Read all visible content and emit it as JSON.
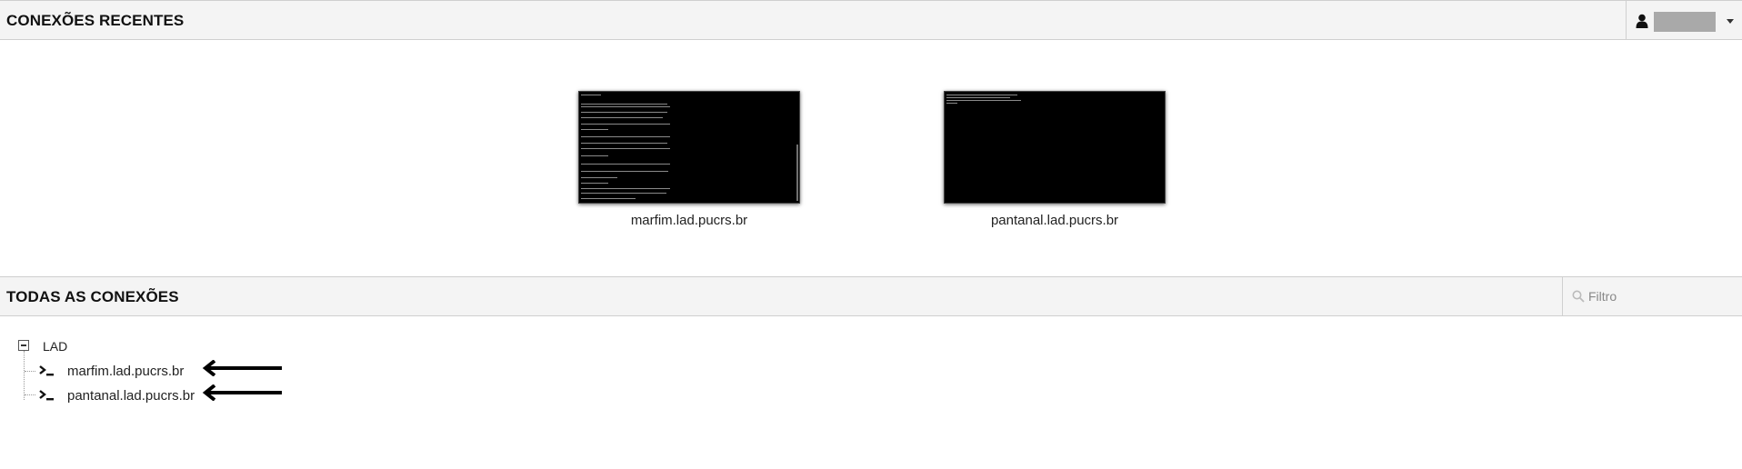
{
  "recent_section": {
    "title": "CONEXÕES RECENTES"
  },
  "user_menu": {
    "icon": "user-icon",
    "username": ""
  },
  "recent_connections": [
    {
      "label": "marfim.lad.pucrs.br"
    },
    {
      "label": "pantanal.lad.pucrs.br"
    }
  ],
  "all_section": {
    "title": "TODAS AS CONEXÕES"
  },
  "filter": {
    "placeholder": "Filtro",
    "value": ""
  },
  "tree": {
    "group_label": "LAD",
    "connections": [
      {
        "label": "marfim.lad.pucrs.br"
      },
      {
        "label": "pantanal.lad.pucrs.br"
      }
    ]
  },
  "colors": {
    "header_bg": "#f4f4f4",
    "thumbnail_bg": "#000000",
    "border": "#cfcfcf"
  }
}
